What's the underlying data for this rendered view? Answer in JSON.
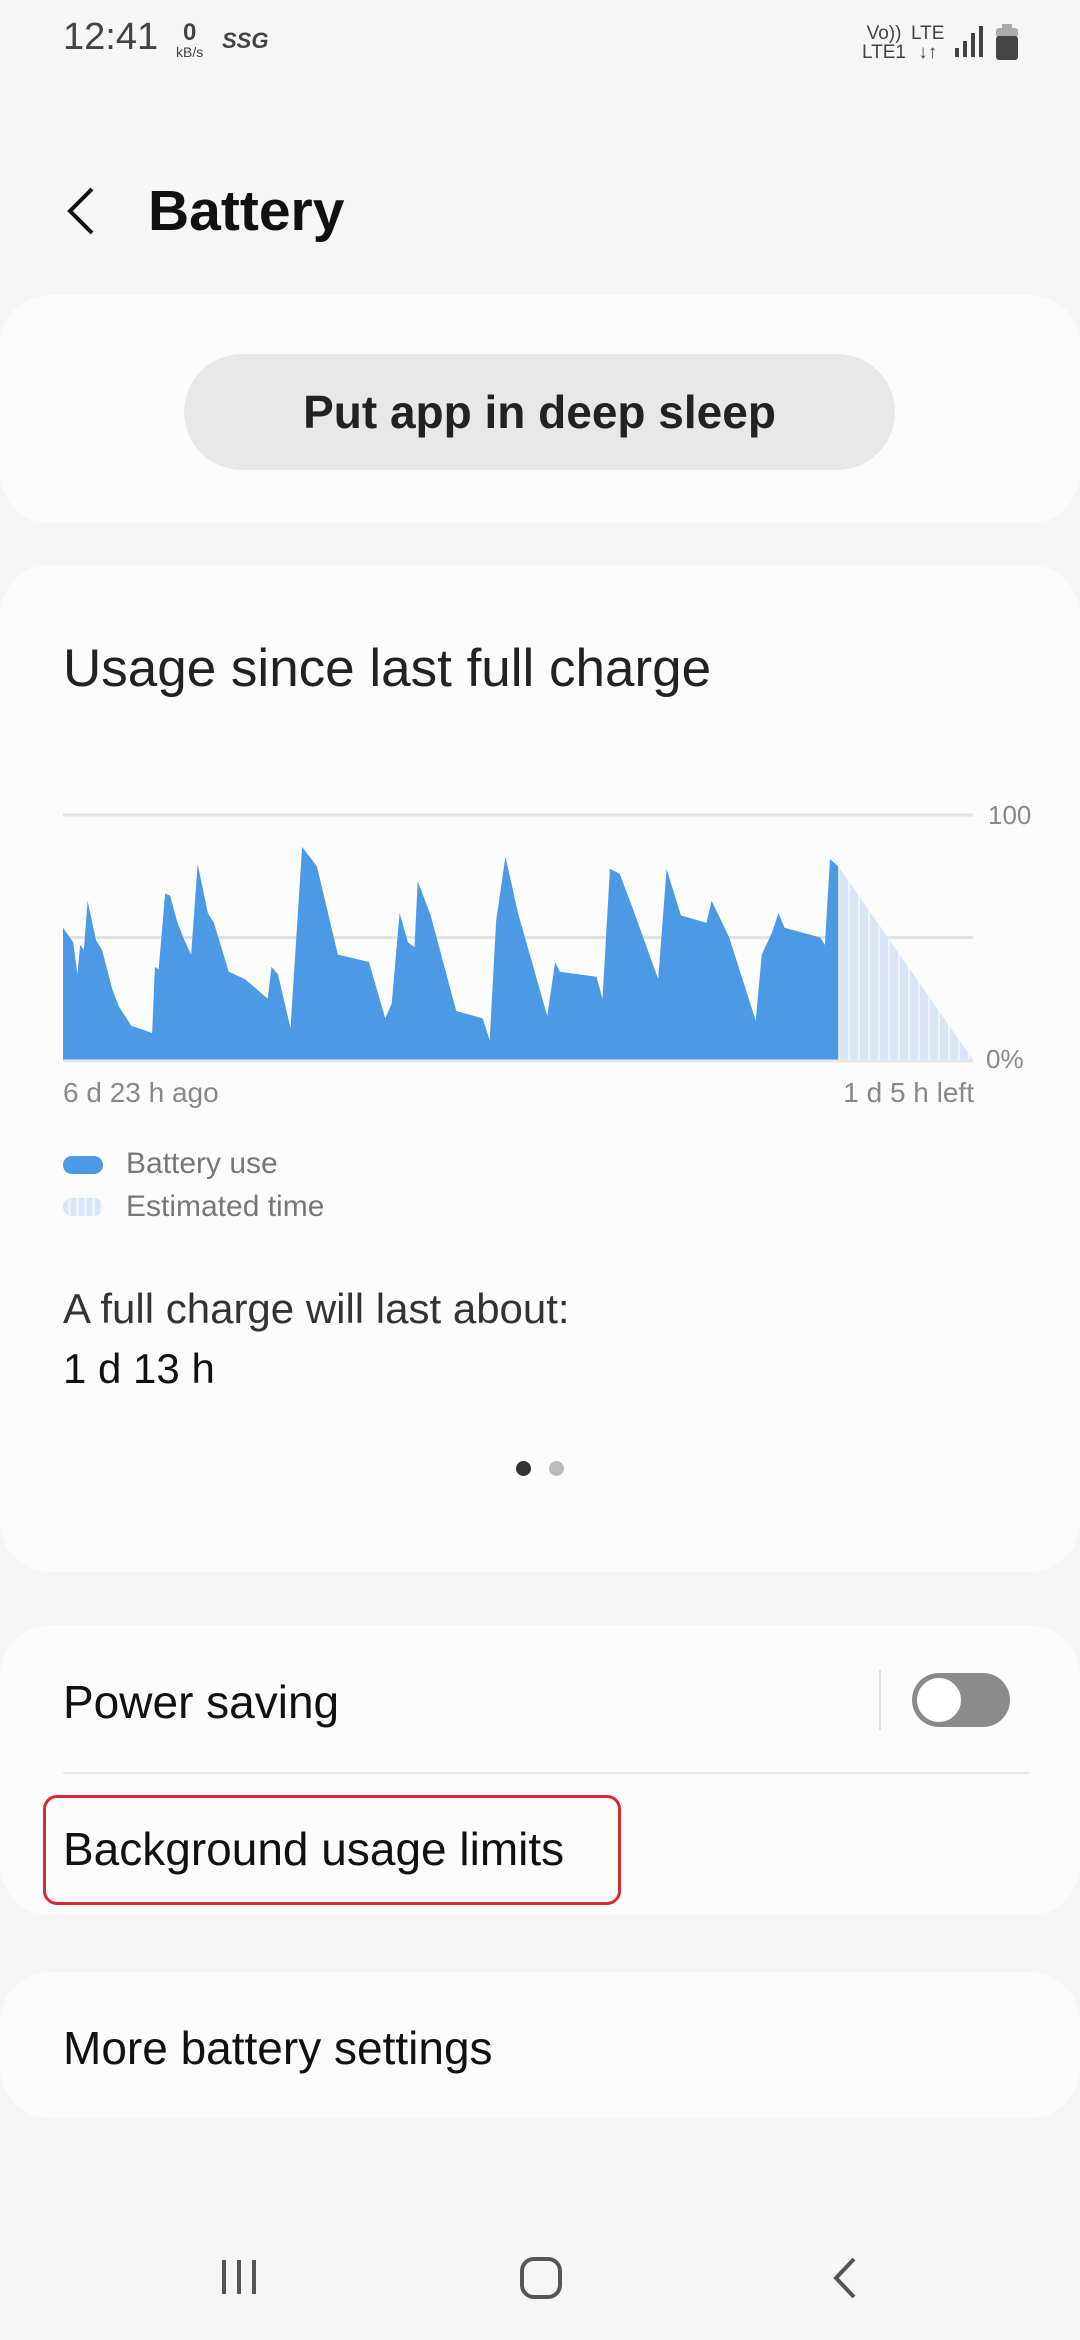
{
  "status_bar": {
    "time": "12:41",
    "net_speed_value": "0",
    "net_speed_unit": "kB/s",
    "carrier_badge": "SSG",
    "volte": "Vo))",
    "lte1": "LTE1",
    "lte": "LTE"
  },
  "header": {
    "title": "Battery",
    "back_icon": "chevron-left-icon"
  },
  "deep_sleep_button": "Put app in deep sleep",
  "usage": {
    "title": "Usage since last full charge",
    "legend": [
      {
        "label": "Battery use",
        "color": "#4c9ae5"
      },
      {
        "label": "Estimated time",
        "color": "#d6e6f8"
      }
    ],
    "full_charge_label": "A full charge will last about:",
    "full_charge_value": "1 d 13 h",
    "page_indicator": {
      "pages": 2,
      "current": 1
    }
  },
  "chart_data": {
    "type": "area",
    "x_unit": "hours relative to now",
    "xlim": [
      -167,
      29
    ],
    "ylim": [
      0,
      100
    ],
    "y_tick_labels": [
      "100",
      "0%"
    ],
    "x_tick_labels": [
      "6 d 23 h ago",
      "1 d 5 h left"
    ],
    "grid": true,
    "series": [
      {
        "name": "Battery use",
        "color": "#4c9ae5",
        "points": [
          [
            -167,
            54
          ],
          [
            -164.8,
            48
          ],
          [
            -163.9,
            35
          ],
          [
            -163.3,
            47
          ],
          [
            -162.5,
            45
          ],
          [
            -161.7,
            65
          ],
          [
            -159.9,
            49
          ],
          [
            -158.6,
            45
          ],
          [
            -156.4,
            29
          ],
          [
            -155,
            22
          ],
          [
            -152.3,
            14
          ],
          [
            -147.8,
            11
          ],
          [
            -147.2,
            38
          ],
          [
            -146.4,
            37
          ],
          [
            -145,
            68
          ],
          [
            -143.9,
            67
          ],
          [
            -142.5,
            57
          ],
          [
            -141.1,
            50
          ],
          [
            -139.4,
            43
          ],
          [
            -138,
            80
          ],
          [
            -135.8,
            60
          ],
          [
            -134.5,
            56
          ],
          [
            -131.3,
            36
          ],
          [
            -127.8,
            33
          ],
          [
            -122.9,
            25
          ],
          [
            -122.1,
            38
          ],
          [
            -120.7,
            35
          ],
          [
            -118,
            13
          ],
          [
            -115.5,
            87
          ],
          [
            -112.3,
            79
          ],
          [
            -107.8,
            43
          ],
          [
            -101.1,
            40
          ],
          [
            -97.6,
            17
          ],
          [
            -96.2,
            23
          ],
          [
            -94.5,
            60
          ],
          [
            -92.7,
            48
          ],
          [
            -91.3,
            46
          ],
          [
            -90.6,
            73
          ],
          [
            -87.8,
            59
          ],
          [
            -82.3,
            20
          ],
          [
            -76.6,
            17
          ],
          [
            -75.1,
            8
          ],
          [
            -73.7,
            57
          ],
          [
            -71.7,
            83
          ],
          [
            -69,
            60
          ],
          [
            -62.7,
            18
          ],
          [
            -61,
            40
          ],
          [
            -60,
            36
          ],
          [
            -52.1,
            34
          ],
          [
            -50.8,
            25
          ],
          [
            -49.2,
            78
          ],
          [
            -47.1,
            76
          ],
          [
            -44.5,
            63
          ],
          [
            -38.8,
            33
          ],
          [
            -37,
            78
          ],
          [
            -33.9,
            59
          ],
          [
            -28.4,
            56
          ],
          [
            -27.3,
            65
          ],
          [
            -23.5,
            50
          ],
          [
            -17.8,
            16
          ],
          [
            -16.5,
            43
          ],
          [
            -14.3,
            52
          ],
          [
            -12.9,
            60
          ],
          [
            -11.6,
            54
          ],
          [
            -3.9,
            50
          ],
          [
            -2.9,
            47
          ],
          [
            -1.8,
            82
          ],
          [
            0,
            79
          ]
        ]
      },
      {
        "name": "Estimated time",
        "color": "#d6e6f8",
        "points": [
          [
            0,
            79
          ],
          [
            29,
            0
          ]
        ]
      }
    ]
  },
  "settings": {
    "power_saving": "Power saving",
    "power_saving_on": false,
    "background_limits": "Background usage limits",
    "more_settings": "More battery settings"
  },
  "nav": {
    "recents": "recents-icon",
    "home": "home-icon",
    "back": "back-icon"
  }
}
